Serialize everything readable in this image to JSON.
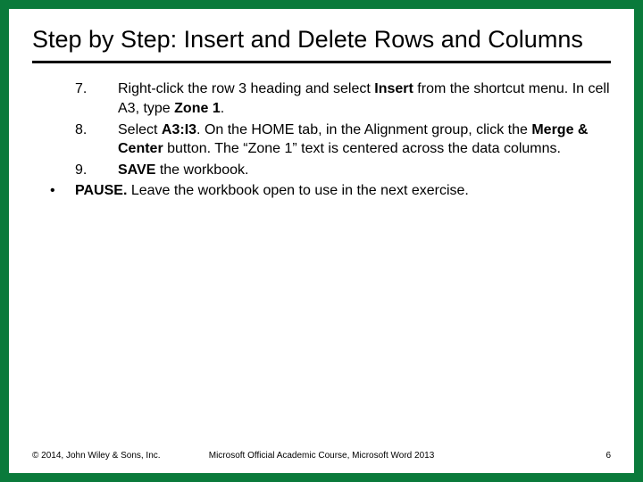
{
  "title": "Step by Step: Insert and Delete Rows and Columns",
  "steps": [
    {
      "num": "7.",
      "segments": [
        {
          "t": "Right-click the row 3 heading and select "
        },
        {
          "t": "Insert",
          "b": true
        },
        {
          "t": " from the shortcut menu. In cell A3, type "
        },
        {
          "t": "Zone 1",
          "b": true
        },
        {
          "t": "."
        }
      ]
    },
    {
      "num": "8.",
      "segments": [
        {
          "t": "Select "
        },
        {
          "t": "A3:I3",
          "b": true
        },
        {
          "t": ". On the HOME tab, in the Alignment group, click the "
        },
        {
          "t": "Merge & Center",
          "b": true
        },
        {
          "t": " button. The “Zone 1” text is centered across the data columns."
        }
      ]
    },
    {
      "num": "9.",
      "segments": [
        {
          "t": " "
        },
        {
          "t": "SAVE",
          "b": true
        },
        {
          "t": " the workbook."
        }
      ]
    }
  ],
  "pause": {
    "label": "PAUSE.",
    "text": " Leave the workbook open to use in the next exercise."
  },
  "footer": {
    "left": "© 2014, John Wiley & Sons, Inc.",
    "mid": "Microsoft Official Academic Course, Microsoft Word 2013",
    "right": "6"
  }
}
